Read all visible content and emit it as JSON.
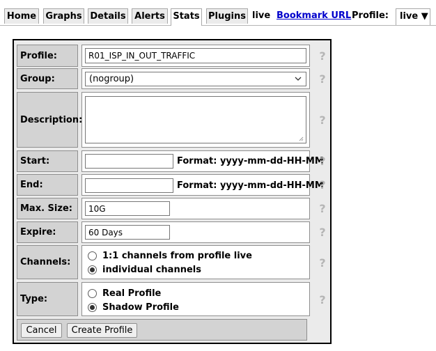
{
  "nav": {
    "tabs": [
      {
        "label": "Home"
      },
      {
        "label": "Graphs"
      },
      {
        "label": "Details"
      },
      {
        "label": "Alerts"
      },
      {
        "label": "Stats"
      },
      {
        "label": "Plugins"
      }
    ],
    "active_tab": "Stats",
    "live_text": "live",
    "bookmark_link": "Bookmark URL",
    "profile_label": "Profile:",
    "profile_select": "live ▼"
  },
  "form": {
    "profile": {
      "label": "Profile:",
      "value": "R01_ISP_IN_OUT_TRAFFIC"
    },
    "group": {
      "label": "Group:",
      "value": "(nogroup)"
    },
    "description": {
      "label": "Description:",
      "value": ""
    },
    "start": {
      "label": "Start:",
      "value": "",
      "format": "Format: yyyy-mm-dd-HH-MM"
    },
    "end": {
      "label": "End:",
      "value": "",
      "format": "Format: yyyy-mm-dd-HH-MM"
    },
    "max_size": {
      "label": "Max. Size:",
      "value": "10G"
    },
    "expire": {
      "label": "Expire:",
      "value": "60 Days"
    },
    "channels": {
      "label": "Channels:",
      "options": [
        "1:1 channels from profile live",
        "individual channels"
      ],
      "selected": "individual channels"
    },
    "type": {
      "label": "Type:",
      "options": [
        "Real Profile",
        "Shadow Profile"
      ],
      "selected": "Shadow Profile"
    },
    "buttons": {
      "cancel": "Cancel",
      "create": "Create Profile"
    }
  },
  "icons": {
    "help": "help-question-icon",
    "dropdown": "chevron-down-icon",
    "resize": "resize-grip-icon"
  },
  "colors": {
    "label_bg": "#d3d3d3",
    "panel_bg": "#ebebeb",
    "link": "#0000cc",
    "tab_bg": "#ebebeb"
  }
}
